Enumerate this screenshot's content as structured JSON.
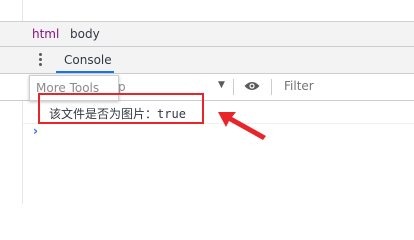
{
  "breadcrumb": {
    "items": [
      "html",
      "body"
    ]
  },
  "drawer": {
    "tabs": [
      "Console"
    ]
  },
  "toolbar": {
    "more_tools_label": "More Tools",
    "context_tail": "p",
    "filter_placeholder": "Filter"
  },
  "console": {
    "messages": [
      {
        "text": "该文件是否为图片：",
        "value": "true"
      }
    ],
    "prompt": "›"
  },
  "colors": {
    "highlight": "#e8262a",
    "accent": "#1a73e8",
    "tag": "#881280"
  },
  "icons": [
    "kebab-menu-icon",
    "dropdown-arrow-icon",
    "eye-icon",
    "prompt-chevron-icon",
    "red-arrow-icon"
  ]
}
